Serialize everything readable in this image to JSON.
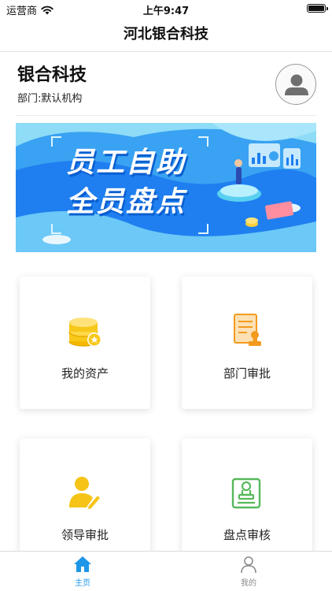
{
  "status_bar": {
    "carrier": "运营商",
    "time": "上午9:47"
  },
  "nav": {
    "title": "河北银合科技"
  },
  "profile": {
    "org_name": "银合科技",
    "department": "部门:默认机构"
  },
  "banner": {
    "line1": "员工自助",
    "line2": "全员盘点"
  },
  "cards": [
    {
      "label": "我的资产",
      "icon": "coins-icon",
      "color": "#f7c81a"
    },
    {
      "label": "部门审批",
      "icon": "approval-document-icon",
      "color": "#f39a1f"
    },
    {
      "label": "领导审批",
      "icon": "leader-sign-icon",
      "color": "#f5c417"
    },
    {
      "label": "盘点审核",
      "icon": "inventory-audit-icon",
      "color": "#57b85c"
    }
  ],
  "tabs": [
    {
      "label": "主页",
      "icon": "home-icon",
      "active": true
    },
    {
      "label": "我的",
      "icon": "user-icon",
      "active": false
    }
  ],
  "colors": {
    "accent": "#1e96e8",
    "banner_blue": "#1f7ff0",
    "banner_light": "#7fd3f4"
  }
}
